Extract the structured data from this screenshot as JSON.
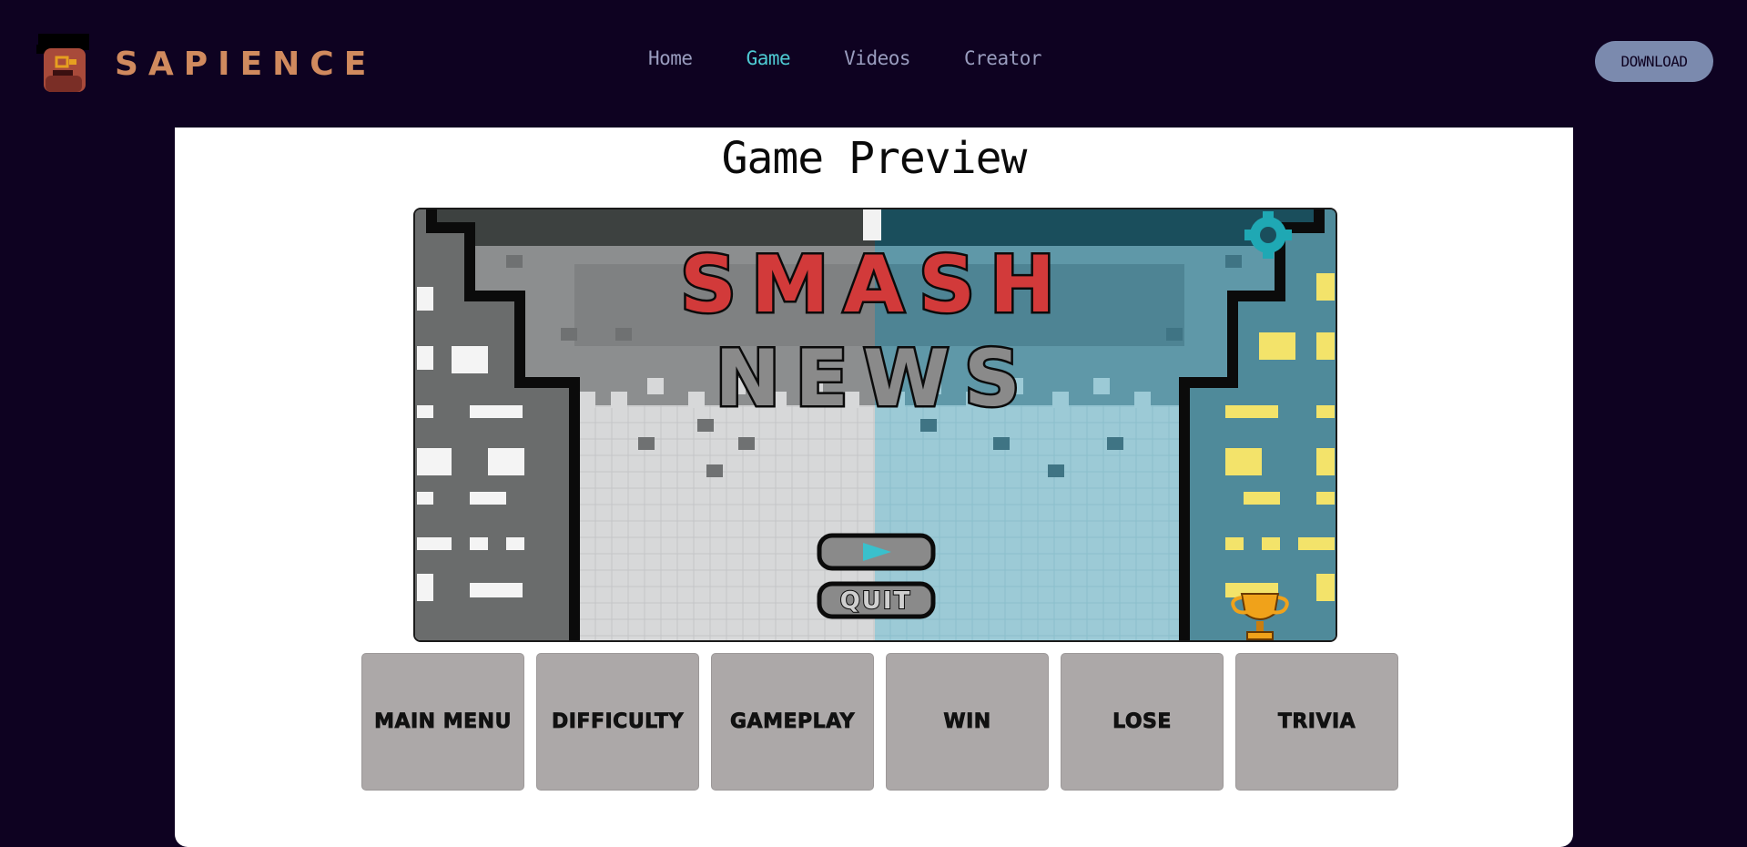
{
  "brand": {
    "name": "SAPIENCE",
    "logo_icon": "pixel-face-icon"
  },
  "nav": {
    "items": [
      {
        "label": "Home",
        "active": false
      },
      {
        "label": "Game",
        "active": true
      },
      {
        "label": "Videos",
        "active": false
      },
      {
        "label": "Creator",
        "active": false
      }
    ],
    "download_label": "DOWNLOAD"
  },
  "preview": {
    "title": "Game Preview",
    "game_title_line1": "SMASH",
    "game_title_line2": "NEWS",
    "quit_label": "QUIT",
    "icons": [
      "gear-icon",
      "play-icon",
      "trophy-icon"
    ]
  },
  "tabs": [
    "MAIN MENU",
    "DIFFICULTY",
    "GAMEPLAY",
    "WIN",
    "LOSE",
    "TRIVIA"
  ],
  "colors": {
    "background": "#0e0221",
    "brand": "#d08a5e",
    "nav_active": "#4ec9d2",
    "nav": "#9a9dbf",
    "download_bg": "#7b8aae",
    "tab_bg": "#aca8a8",
    "smash_red": "#d23a3a"
  }
}
